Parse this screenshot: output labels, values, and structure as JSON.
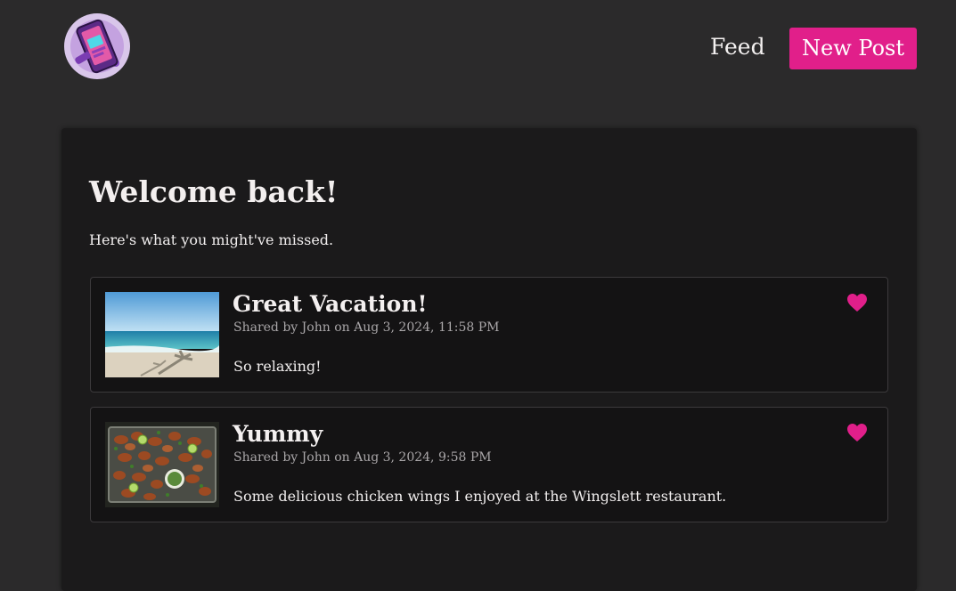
{
  "header": {
    "logo_icon": "phone-logo-icon",
    "nav": {
      "feed_label": "Feed",
      "new_post_label": "New Post"
    }
  },
  "main": {
    "title": "Welcome back!",
    "subtitle": "Here's what you might've missed.",
    "posts": [
      {
        "title": "Great Vacation!",
        "meta": "Shared by John on Aug 3, 2024, 11:58 PM",
        "body": "So relaxing!",
        "image_icon": "beach-photo",
        "liked": true
      },
      {
        "title": "Yummy",
        "meta": "Shared by John on Aug 3, 2024, 9:58 PM",
        "body": "Some delicious chicken wings I enjoyed at the Wingslett restaurant.",
        "image_icon": "chicken-wings-photo",
        "liked": true
      }
    ]
  },
  "colors": {
    "background": "#2b2a2b",
    "panel": "#1b1a1b",
    "card": "#141314",
    "accent": "#e11f8a"
  }
}
